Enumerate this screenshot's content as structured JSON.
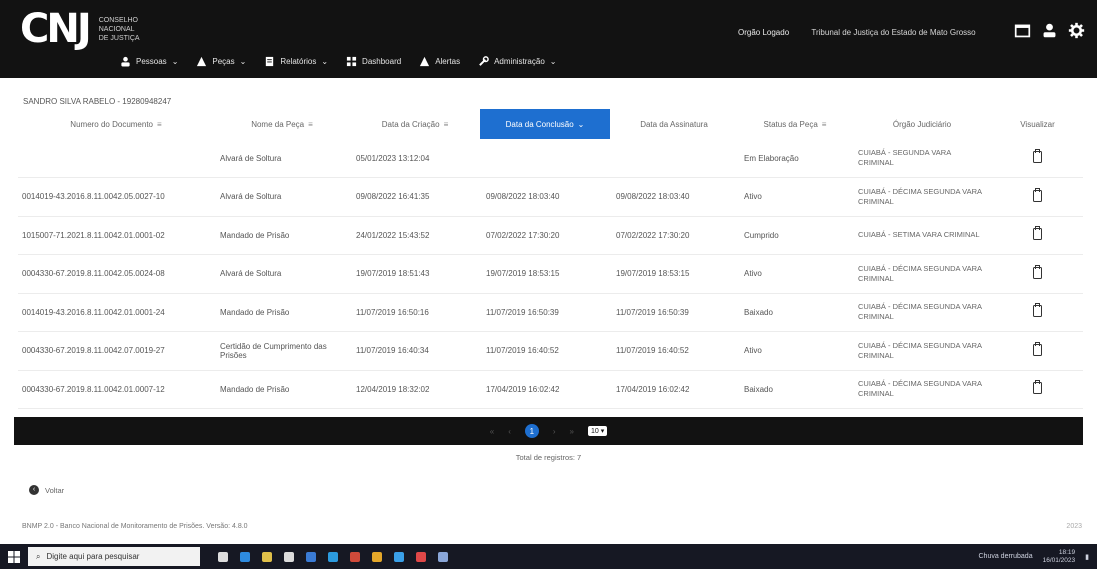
{
  "header": {
    "logo_text": "CNJ",
    "logo_sub": [
      "Conselho",
      "Nacional",
      "de Justiça"
    ],
    "user_label": "Orgão Logado",
    "org_name": "Tribunal de Justiça do Estado de Mato Grosso",
    "icons": [
      "folder-icon",
      "user-icon",
      "gear-icon"
    ]
  },
  "nav": {
    "items": [
      {
        "label": "Pessoas",
        "icon": "person-icon"
      },
      {
        "label": "Peças",
        "icon": "pieces-icon"
      },
      {
        "label": "Relatórios",
        "icon": "report-icon"
      },
      {
        "label": "Dashboard",
        "icon": "dashboard-icon"
      },
      {
        "label": "Alertas",
        "icon": "alert-icon"
      },
      {
        "label": "Administração",
        "icon": "wrench-icon"
      }
    ]
  },
  "person": {
    "title": "SANDRO SILVA RABELO - 19280948247"
  },
  "table": {
    "columns": [
      {
        "label": "Numero do Documento",
        "sortable": true
      },
      {
        "label": "Nome da Peça",
        "sortable": true
      },
      {
        "label": "Data da Criação",
        "sortable": true
      },
      {
        "label": "Data da Conclusão",
        "sortable": true,
        "active": true
      },
      {
        "label": "Data da Assinatura",
        "sortable": false
      },
      {
        "label": "Status da Peça",
        "sortable": true
      },
      {
        "label": "Órgão Judiciário",
        "sortable": false
      },
      {
        "label": "Visualizar",
        "sortable": false
      }
    ],
    "rows": [
      {
        "doc": "",
        "name": "Alvará de Soltura",
        "created": "05/01/2023 13:12:04",
        "concluded": "",
        "signed": "",
        "status": "Em Elaboração",
        "org": "CUIABÁ - SEGUNDA VARA CRIMINAL"
      },
      {
        "doc": "0014019-43.2016.8.11.0042.05.0027-10",
        "name": "Alvará de Soltura",
        "created": "09/08/2022 16:41:35",
        "concluded": "09/08/2022 18:03:40",
        "signed": "09/08/2022 18:03:40",
        "status": "Ativo",
        "org": "CUIABÁ - DÉCIMA SEGUNDA VARA CRIMINAL"
      },
      {
        "doc": "1015007-71.2021.8.11.0042.01.0001-02",
        "name": "Mandado de Prisão",
        "created": "24/01/2022 15:43:52",
        "concluded": "07/02/2022 17:30:20",
        "signed": "07/02/2022 17:30:20",
        "status": "Cumprido",
        "org": "CUIABÁ - SETIMA VARA CRIMINAL"
      },
      {
        "doc": "0004330-67.2019.8.11.0042.05.0024-08",
        "name": "Alvará de Soltura",
        "created": "19/07/2019 18:51:43",
        "concluded": "19/07/2019 18:53:15",
        "signed": "19/07/2019 18:53:15",
        "status": "Ativo",
        "org": "CUIABÁ - DÉCIMA SEGUNDA VARA CRIMINAL"
      },
      {
        "doc": "0014019-43.2016.8.11.0042.01.0001-24",
        "name": "Mandado de Prisão",
        "created": "11/07/2019 16:50:16",
        "concluded": "11/07/2019 16:50:39",
        "signed": "11/07/2019 16:50:39",
        "status": "Baixado",
        "org": "CUIABÁ - DÉCIMA SEGUNDA VARA CRIMINAL"
      },
      {
        "doc": "0004330-67.2019.8.11.0042.07.0019-27",
        "name": "Certidão de Cumprimento das Prisões",
        "created": "11/07/2019 16:40:34",
        "concluded": "11/07/2019 16:40:52",
        "signed": "11/07/2019 16:40:52",
        "status": "Ativo",
        "org": "CUIABÁ - DÉCIMA SEGUNDA VARA CRIMINAL"
      },
      {
        "doc": "0004330-67.2019.8.11.0042.01.0007-12",
        "name": "Mandado de Prisão",
        "created": "12/04/2019 18:32:02",
        "concluded": "17/04/2019 16:02:42",
        "signed": "17/04/2019 16:02:42",
        "status": "Baixado",
        "org": "CUIABÁ - DÉCIMA SEGUNDA VARA CRIMINAL"
      }
    ]
  },
  "pagination": {
    "current_page": "1",
    "per_page": "10"
  },
  "total_label": "Total de registros: 7",
  "back_label": "Voltar",
  "footer": {
    "text": "BNMP 2.0 - Banco Nacional de Monitoramento de Prisões. Versão: 4.8.0",
    "year": "2023"
  },
  "taskbar": {
    "search_placeholder": "Digite aqui para pesquisar",
    "tray_text": "Chuva derrubada",
    "time": "18:19",
    "date": "16/01/2023"
  },
  "colors": {
    "topbar": "#121212",
    "accent": "#1e6fd0"
  }
}
